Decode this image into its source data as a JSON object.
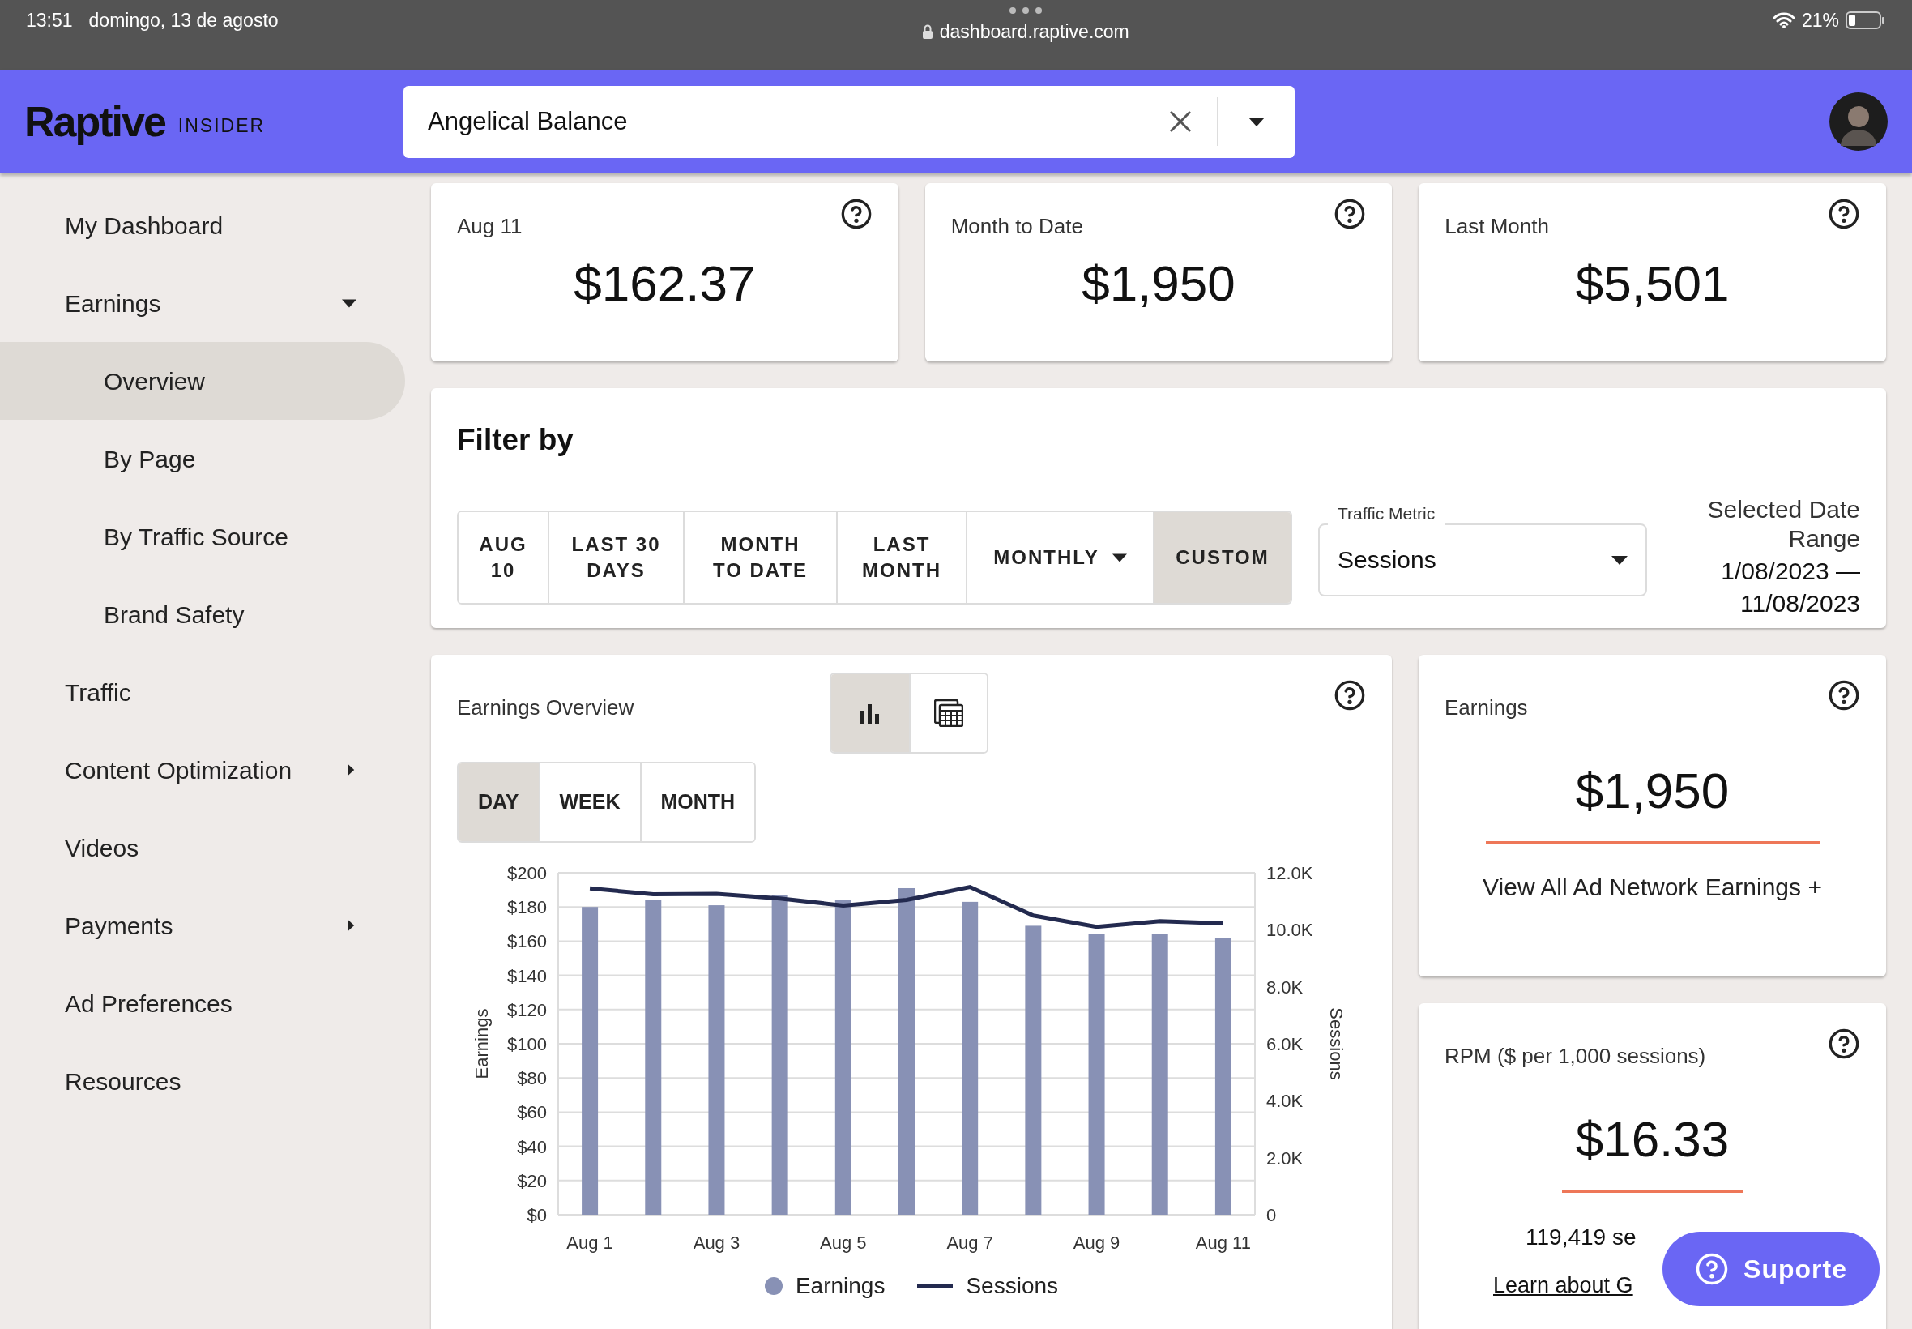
{
  "status_bar": {
    "time": "13:51",
    "date": "domingo, 13 de agosto",
    "url": "dashboard.raptive.com",
    "battery": "21%"
  },
  "header": {
    "logo": "Raptive",
    "logo_tag": "INSIDER",
    "search": {
      "value": "Angelical Balance"
    }
  },
  "sidebar": {
    "items": [
      {
        "label": "My Dashboard",
        "selected": false
      },
      {
        "label": "Earnings",
        "selected": false,
        "expanded": true,
        "children": [
          {
            "label": "Overview",
            "selected": true
          },
          {
            "label": "By Page",
            "selected": false
          },
          {
            "label": "By Traffic Source",
            "selected": false
          },
          {
            "label": "Brand Safety",
            "selected": false
          }
        ]
      },
      {
        "label": "Traffic",
        "selected": false
      },
      {
        "label": "Content Optimization",
        "selected": false,
        "expanded": false
      },
      {
        "label": "Videos",
        "selected": false
      },
      {
        "label": "Payments",
        "selected": false,
        "expanded": false
      },
      {
        "label": "Ad Preferences",
        "selected": false
      },
      {
        "label": "Resources",
        "selected": false
      }
    ]
  },
  "stat_cards": [
    {
      "label": "Aug 11",
      "value": "$162.37"
    },
    {
      "label": "Month to Date",
      "value": "$1,950"
    },
    {
      "label": "Last Month",
      "value": "$5,501"
    }
  ],
  "filter": {
    "title": "Filter by",
    "range_buttons": [
      {
        "label": "AUG 10",
        "kind": "button",
        "selected": false
      },
      {
        "label": "LAST 30 DAYS",
        "kind": "button",
        "selected": false
      },
      {
        "label": "MONTH TO DATE",
        "kind": "button",
        "selected": false
      },
      {
        "label": "LAST MONTH",
        "kind": "button",
        "selected": false
      },
      {
        "label": "MONTHLY",
        "kind": "dropdown",
        "selected": false
      },
      {
        "label": "CUSTOM",
        "kind": "button",
        "selected": true
      }
    ],
    "traffic_metric": {
      "label": "Traffic Metric",
      "value": "Sessions"
    },
    "selected_range": {
      "label": "Selected Date Range",
      "value": "1/08/2023 — 11/08/2023"
    }
  },
  "earnings_overview": {
    "title": "Earnings Overview",
    "view_toggle": [
      {
        "kind": "chart",
        "selected": true
      },
      {
        "kind": "table",
        "selected": false
      }
    ],
    "periods": [
      {
        "label": "DAY",
        "selected": true
      },
      {
        "label": "WEEK",
        "selected": false
      },
      {
        "label": "MONTH",
        "selected": false
      }
    ],
    "chart_data": {
      "type": "bar",
      "grid": true,
      "legend": "bottom",
      "ylabel": "Earnings",
      "y2label": "Sessions",
      "categories": [
        "Aug 1",
        null,
        "Aug 3",
        null,
        "Aug 5",
        null,
        "Aug 7",
        null,
        "Aug 9",
        null,
        "Aug 11"
      ],
      "ylim": [
        0,
        200
      ],
      "yticks": [
        {
          "value": 0,
          "label": "$0"
        },
        {
          "value": 20,
          "label": "$20"
        },
        {
          "value": 40,
          "label": "$40"
        },
        {
          "value": 60,
          "label": "$60"
        },
        {
          "value": 80,
          "label": "$80"
        },
        {
          "value": 100,
          "label": "$100"
        },
        {
          "value": 120,
          "label": "$120"
        },
        {
          "value": 140,
          "label": "$140"
        },
        {
          "value": 160,
          "label": "$160"
        },
        {
          "value": 180,
          "label": "$180"
        },
        {
          "value": 200,
          "label": "$200"
        }
      ],
      "y2lim": [
        0,
        12000
      ],
      "y2ticks": [
        {
          "value": 0,
          "label": "0"
        },
        {
          "value": 2000,
          "label": "2.0K"
        },
        {
          "value": 4000,
          "label": "4.0K"
        },
        {
          "value": 6000,
          "label": "6.0K"
        },
        {
          "value": 8000,
          "label": "8.0K"
        },
        {
          "value": 10000,
          "label": "10.0K"
        },
        {
          "value": 12000,
          "label": "12.0K"
        }
      ],
      "series": [
        {
          "name": "Earnings",
          "color": "#8891b5",
          "axis": "y",
          "values": [
            180,
            184,
            181,
            187,
            184,
            191,
            183,
            169,
            164,
            164,
            162
          ]
        },
        {
          "name": "Sessions",
          "color": "#232a4f",
          "type": "line",
          "axis": "y2",
          "values": [
            11450,
            11250,
            11260,
            11100,
            10850,
            11050,
            11500,
            10500,
            10100,
            10300,
            10220
          ]
        }
      ]
    }
  },
  "earnings_card": {
    "label": "Earnings",
    "value": "$1,950",
    "link": "View All Ad Network Earnings +"
  },
  "rpm_card": {
    "label": "RPM ($ per 1,000 sessions)",
    "value": "$16.33",
    "sessions": "119,419 se",
    "link": "Learn about G"
  },
  "support_button": {
    "label": "Suporte"
  }
}
